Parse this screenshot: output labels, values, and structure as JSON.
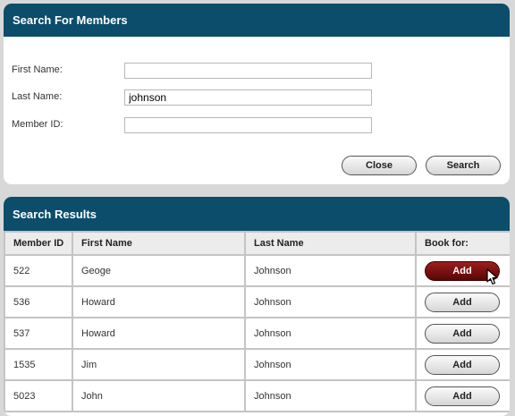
{
  "search_panel": {
    "title": "Search For Members",
    "fields": [
      {
        "label": "First Name:",
        "value": ""
      },
      {
        "label": "Last Name:",
        "value": "johnson"
      },
      {
        "label": "Member ID:",
        "value": ""
      }
    ],
    "close_label": "Close",
    "search_label": "Search"
  },
  "results_panel": {
    "title": "Search Results",
    "columns": [
      "Member ID",
      "First Name",
      "Last Name",
      "Book for:"
    ],
    "rows": [
      {
        "member_id": "522",
        "first_name": "Geoge",
        "last_name": "Johnson",
        "action": "Add"
      },
      {
        "member_id": "536",
        "first_name": "Howard",
        "last_name": "Johnson",
        "action": "Add"
      },
      {
        "member_id": "537",
        "first_name": "Howard",
        "last_name": "Johnson",
        "action": "Add"
      },
      {
        "member_id": "1535",
        "first_name": "Jim",
        "last_name": "Johnson",
        "action": "Add"
      },
      {
        "member_id": "5023",
        "first_name": "John",
        "last_name": "Johnson",
        "action": "Add"
      }
    ]
  },
  "colors": {
    "header_bg": "#0b4d6b",
    "active_button": "#7a0f0f"
  }
}
